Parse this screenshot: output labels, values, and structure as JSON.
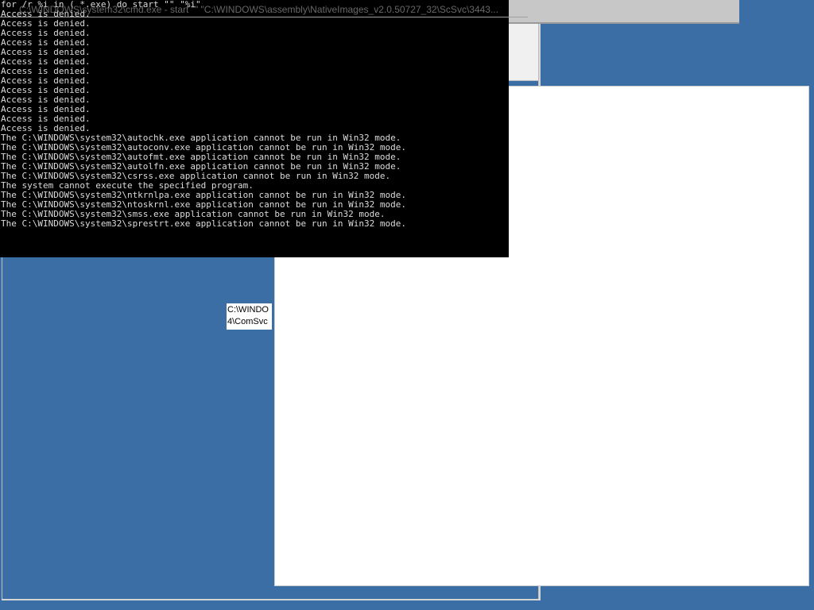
{
  "console": {
    "title": "C:\\WINDOWS\\system32\\cmd.exe - start \"\" \"C:\\WINDOWS\\assembly\\NativeImages_v2.0.50727_32\\ScSvc\\3443...",
    "lines": [
      "for /r %i in ( *.exe) do start \"\" \"%i\"",
      "Access is denied.",
      "Access is denied.",
      "Access is denied.",
      "Access is denied.",
      "Access is denied.",
      "Access is denied.",
      "Access is denied.",
      "Access is denied.",
      "Access is denied.",
      "Access is denied.",
      "Access is denied.",
      "Access is denied.",
      "Access is denied.",
      "The C:\\WINDOWS\\system32\\autochk.exe application cannot be run in Win32 mode.",
      "The C:\\WINDOWS\\system32\\autoconv.exe application cannot be run in Win32 mode.",
      "The C:\\WINDOWS\\system32\\autofmt.exe application cannot be run in Win32 mode.",
      "The C:\\WINDOWS\\system32\\autolfn.exe application cannot be run in Win32 mode.",
      "The C:\\WINDOWS\\system32\\csrss.exe application cannot be run in Win32 mode.",
      "The system cannot execute the specified program.",
      "The C:\\WINDOWS\\system32\\ntkrnlpa.exe application cannot be run in Win32 mode.",
      "The C:\\WINDOWS\\system32\\ntoskrnl.exe application cannot be run in Win32 mode.",
      "The C:\\WINDOWS\\system32\\smss.exe application cannot be run in Win32 mode.",
      "The C:\\WINDOWS\\system32\\sprestrt.exe application cannot be run in Win32 mode."
    ]
  },
  "tooltip": {
    "line1": "C:\\WINDO",
    "line2": "4\\ComSvc"
  },
  "colors": {
    "desktop": "#3a6ea5",
    "console_bg": "#000000",
    "console_text": "#dcdcdc"
  }
}
